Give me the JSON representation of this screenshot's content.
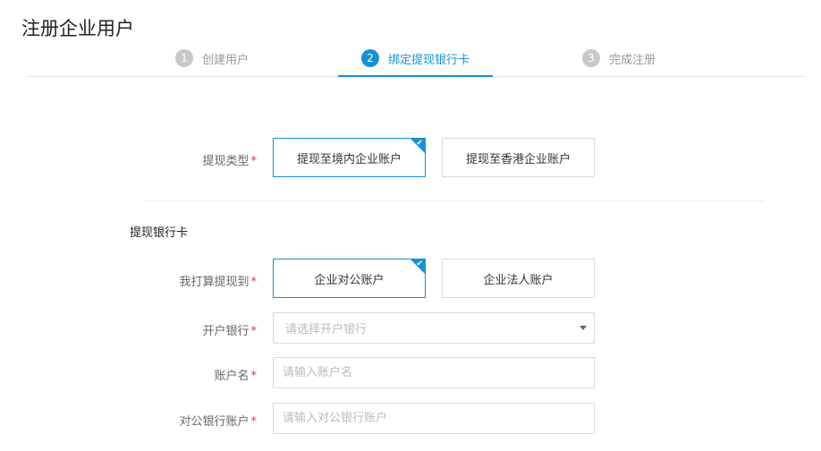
{
  "page": {
    "title": "注册企业用户"
  },
  "steps": [
    {
      "num": "1",
      "label": "创建用户"
    },
    {
      "num": "2",
      "label": "绑定提现银行卡"
    },
    {
      "num": "3",
      "label": "完成注册"
    }
  ],
  "withdraw_type": {
    "label": "提现类型",
    "options": [
      "提现至境内企业账户",
      "提现至香港企业账户"
    ]
  },
  "section_title": "提现银行卡",
  "account_type": {
    "label": "我打算提现到",
    "options": [
      "企业对公账户",
      "企业法人账户"
    ]
  },
  "bank": {
    "label": "开户银行",
    "placeholder": "请选择开户银行"
  },
  "account_name": {
    "label": "账户名",
    "placeholder": "请输入账户名"
  },
  "account_number": {
    "label": "对公银行账户",
    "placeholder": "请输入对公银行账户"
  },
  "required_mark": "*",
  "colors": {
    "accent": "#1591d6",
    "required": "#e23b3b"
  }
}
